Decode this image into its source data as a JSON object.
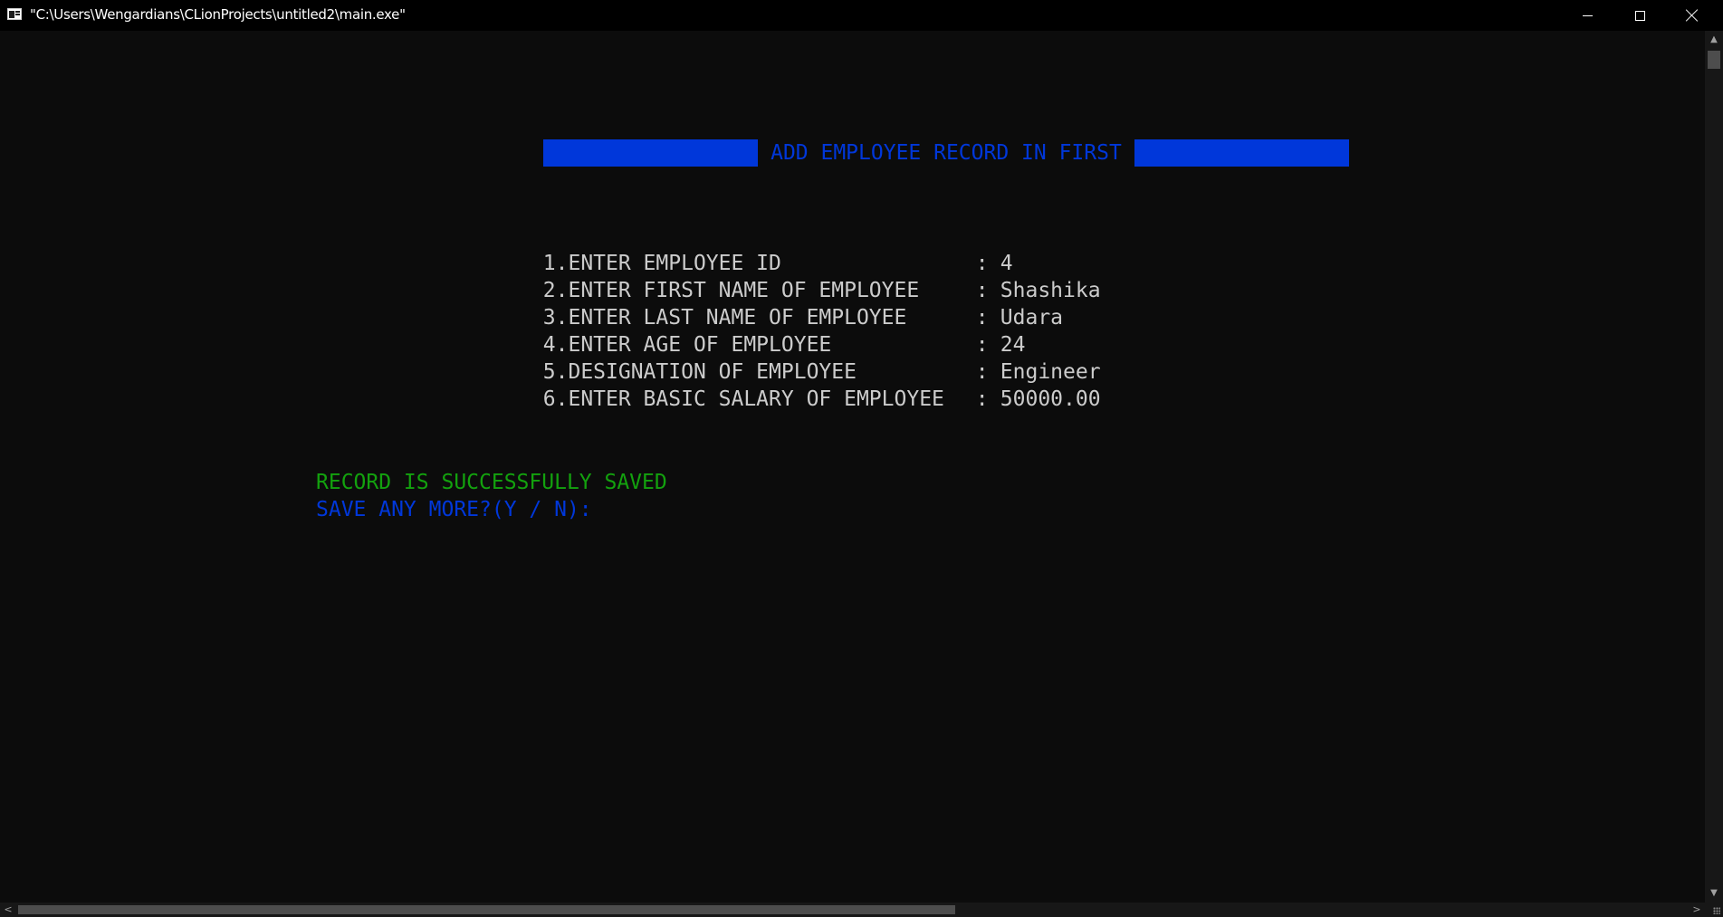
{
  "window": {
    "title": "\"C:\\Users\\Wengardians\\CLionProjects\\untitled2\\main.exe\"",
    "icon": "console-app-icon",
    "controls": {
      "minimize_icon": "minimize-icon",
      "maximize_icon": "maximize-icon",
      "close_icon": "close-icon"
    }
  },
  "console": {
    "banner": {
      "text": "ADD EMPLOYEE RECORD IN FIRST",
      "color": "#0037da"
    },
    "fields": [
      {
        "label": "1.ENTER EMPLOYEE ID",
        "value": "4"
      },
      {
        "label": "2.ENTER FIRST NAME OF EMPLOYEE",
        "value": "Shashika"
      },
      {
        "label": "3.ENTER LAST NAME OF EMPLOYEE",
        "value": "Udara"
      },
      {
        "label": "4.ENTER AGE OF EMPLOYEE",
        "value": "24"
      },
      {
        "label": "5.DESIGNATION OF EMPLOYEE",
        "value": "Engineer"
      },
      {
        "label": "6.ENTER BASIC SALARY OF EMPLOYEE",
        "value": "50000.00"
      }
    ],
    "separator": ":",
    "success_message": "RECORD IS SUCCESSFULLY SAVED",
    "prompt": "SAVE ANY MORE?(Y / N):",
    "colors": {
      "background": "#0c0c0c",
      "text": "#cccccc",
      "success": "#13a10e",
      "prompt": "#0037da"
    }
  },
  "scrollbars": {
    "vertical": {
      "up_icon": "scroll-up-arrow-icon",
      "down_icon": "scroll-down-arrow-icon"
    },
    "horizontal": {
      "left_icon": "scroll-left-arrow-icon",
      "right_icon": "scroll-right-arrow-icon"
    }
  }
}
